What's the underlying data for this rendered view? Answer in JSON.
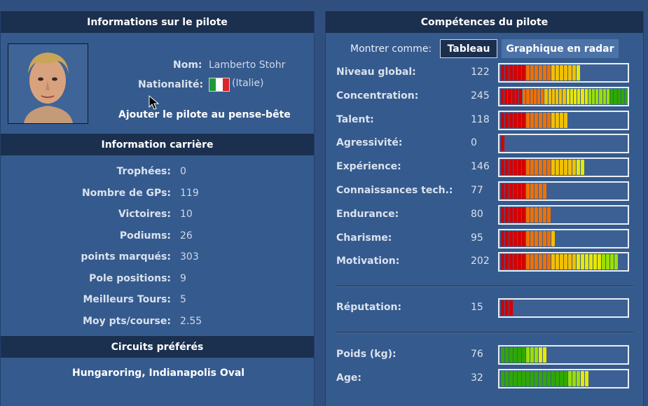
{
  "left": {
    "header_info": "Informations sur le pilote",
    "name_label": "Nom:",
    "name_value": "Lamberto Stohr",
    "nationality_label": "Nationalité:",
    "nationality_value": "(Italie)",
    "add_button": "Ajouter le pilote au pense-bête",
    "header_career": "Information carrière",
    "career": [
      {
        "label": "Trophées:",
        "value": "0"
      },
      {
        "label": "Nombre de GPs:",
        "value": "119"
      },
      {
        "label": "Victoires:",
        "value": "10"
      },
      {
        "label": "Podiums:",
        "value": "26"
      },
      {
        "label": "points marqués:",
        "value": "303"
      },
      {
        "label": "Pole positions:",
        "value": "9"
      },
      {
        "label": "Meilleurs Tours:",
        "value": "5"
      },
      {
        "label": "Moy pts/course:",
        "value": "2.55"
      }
    ],
    "header_circuits": "Circuits préférés",
    "circuits": "Hungaroring, Indianapolis Oval"
  },
  "right": {
    "header": "Compétences du pilote",
    "show_as": "Montrer comme:",
    "tab_table": "Tableau",
    "tab_radar": "Graphique en radar",
    "skills": [
      {
        "label": "Niveau global:",
        "value": "122",
        "segments": 19
      },
      {
        "label": "Concentration:",
        "value": "245",
        "segments": 35
      },
      {
        "label": "Talent:",
        "value": "118",
        "segments": 16
      },
      {
        "label": "Agressivité:",
        "value": "0",
        "segments": 1
      },
      {
        "label": "Expérience:",
        "value": "146",
        "segments": 20
      },
      {
        "label": "Connaissances tech.:",
        "value": "77",
        "segments": 11
      },
      {
        "label": "Endurance:",
        "value": "80",
        "segments": 12
      },
      {
        "label": "Charisme:",
        "value": "95",
        "segments": 13
      },
      {
        "label": "Motivation:",
        "value": "202",
        "segments": 28
      }
    ],
    "reputation": {
      "label": "Réputation:",
      "value": "15",
      "segments": 3
    },
    "physical": [
      {
        "label": "Poids (kg):",
        "value": "76",
        "segments": 11
      },
      {
        "label": "Age:",
        "value": "32",
        "segments": 21
      }
    ]
  },
  "colors": {
    "gradient": [
      "#d40000",
      "#f07000",
      "#f0c000",
      "#e8e800",
      "#9adf00",
      "#2fa800"
    ],
    "green_scale": [
      "#2fa800",
      "#9adf00",
      "#e8e800"
    ]
  }
}
